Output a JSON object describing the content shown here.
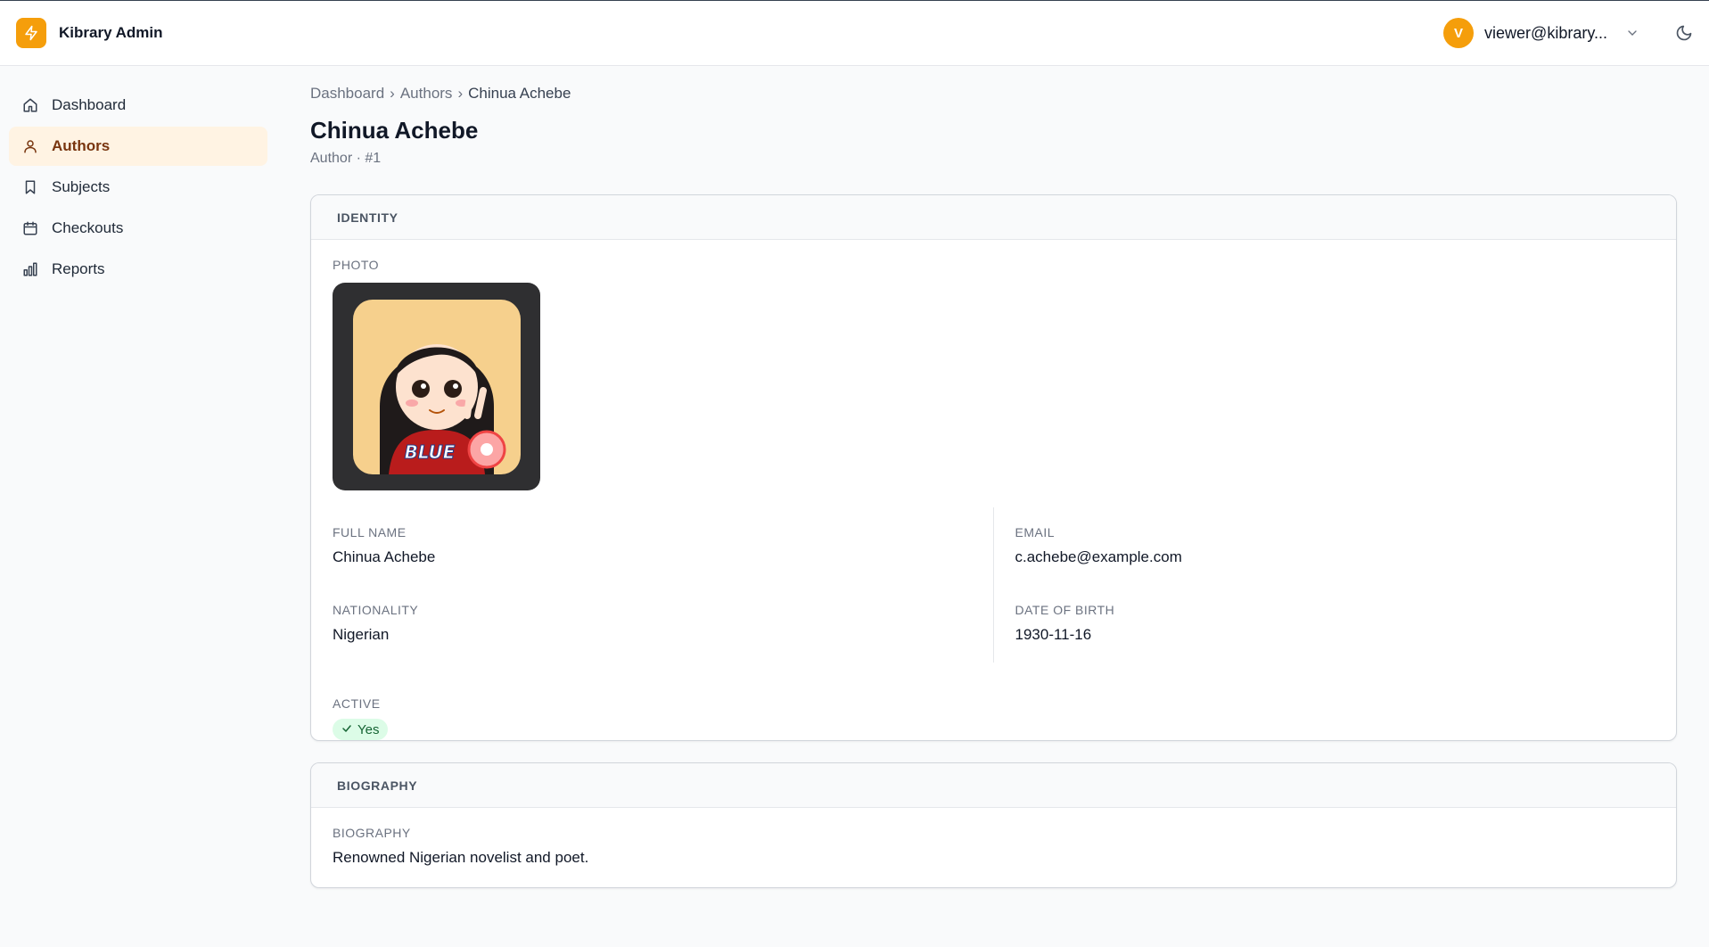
{
  "app": {
    "title": "Kibrary Admin"
  },
  "user": {
    "initial": "V",
    "email": "viewer@kibrary..."
  },
  "sidebar": {
    "items": [
      {
        "label": "Dashboard",
        "icon": "home-icon"
      },
      {
        "label": "Authors",
        "icon": "user-icon",
        "active": true
      },
      {
        "label": "Subjects",
        "icon": "bookmark-icon"
      },
      {
        "label": "Checkouts",
        "icon": "calendar-icon"
      },
      {
        "label": "Reports",
        "icon": "bar-chart-icon"
      }
    ]
  },
  "breadcrumb": {
    "items": [
      "Dashboard",
      "Authors",
      "Chinua Achebe"
    ],
    "separator": "›"
  },
  "page": {
    "title": "Chinua Achebe",
    "subtitle": "Author · #1"
  },
  "identity": {
    "header": "IDENTITY",
    "photo_label": "PHOTO",
    "photo_text": "BLUE",
    "fields": {
      "full_name": {
        "label": "FULL NAME",
        "value": "Chinua Achebe"
      },
      "email": {
        "label": "EMAIL",
        "value": "c.achebe@example.com"
      },
      "nationality": {
        "label": "NATIONALITY",
        "value": "Nigerian"
      },
      "date_of_birth": {
        "label": "DATE OF BIRTH",
        "value": "1930-11-16"
      }
    },
    "active": {
      "label": "ACTIVE",
      "value": "Yes"
    }
  },
  "biography": {
    "header": "BIOGRAPHY",
    "label": "BIOGRAPHY",
    "value": "Renowned Nigerian novelist and poet."
  },
  "colors": {
    "accent": "#f59e0b",
    "active_nav_bg": "#fff3e3",
    "badge_bg": "#dcfce7",
    "badge_text": "#166534"
  }
}
